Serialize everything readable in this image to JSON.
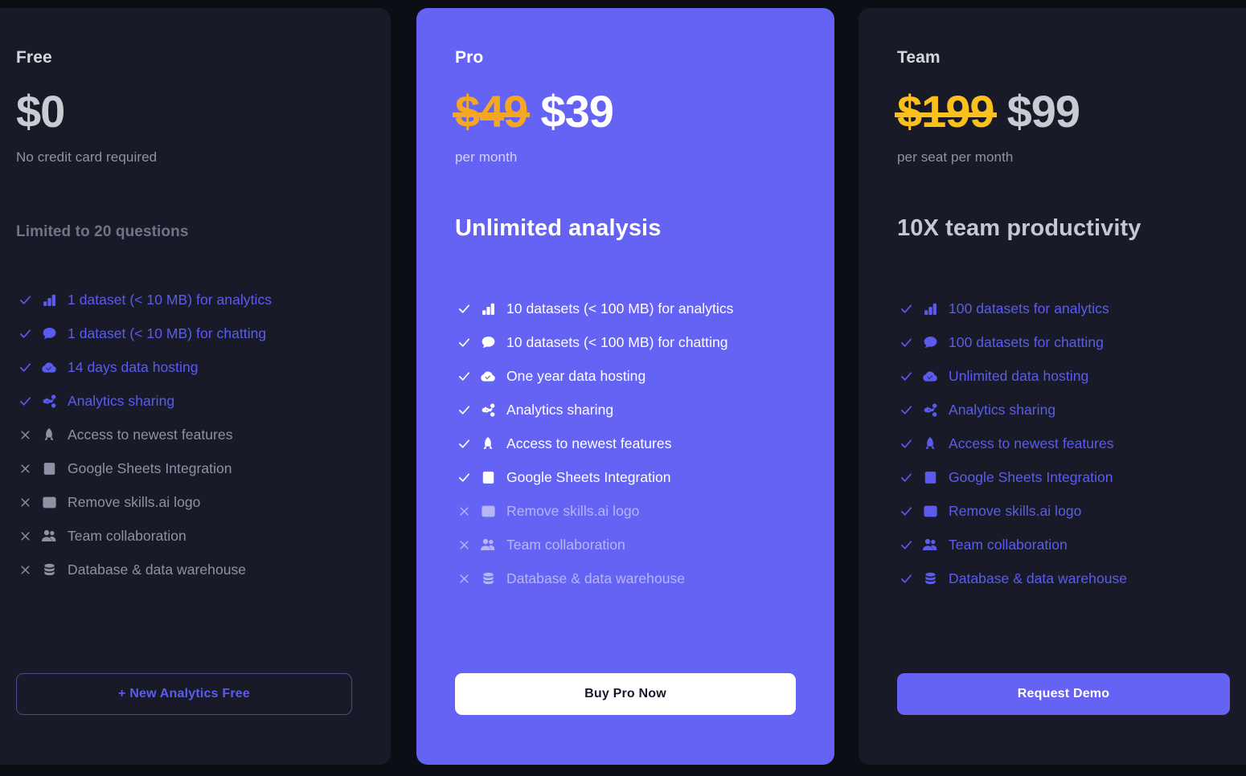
{
  "theme": {
    "page_background": "#0c0e15",
    "card_background": "#181b27",
    "accent_purple": "#6563f4",
    "feature_purple": "#5b5bf0",
    "strike_orange": "#f5a623",
    "strike_yellow": "#fcc01c",
    "muted_text": "#8d92a4"
  },
  "plans": [
    {
      "id": "free",
      "name": "Free",
      "old_price": "",
      "price": "$0",
      "price_note": "No credit card required",
      "tagline": "Limited to 20 questions",
      "cta_label": "+ New Analytics Free",
      "features": [
        {
          "icon": "bar-chart-icon",
          "label": "1 dataset (< 10 MB) for analytics",
          "included": true
        },
        {
          "icon": "chat-bubble-icon",
          "label": "1 dataset (< 10 MB) for chatting",
          "included": true
        },
        {
          "icon": "cloud-check-icon",
          "label": "14 days data hosting",
          "included": true
        },
        {
          "icon": "share-icon",
          "label": "Analytics sharing",
          "included": true
        },
        {
          "icon": "rocket-icon",
          "label": "Access to newest features",
          "included": false
        },
        {
          "icon": "spreadsheet-icon",
          "label": "Google Sheets Integration",
          "included": false
        },
        {
          "icon": "image-icon",
          "label": "Remove skills.ai logo",
          "included": false
        },
        {
          "icon": "people-icon",
          "label": "Team collaboration",
          "included": false
        },
        {
          "icon": "database-icon",
          "label": "Database & data warehouse",
          "included": false
        }
      ]
    },
    {
      "id": "pro",
      "name": "Pro",
      "old_price": "$49",
      "price": "$39",
      "price_note": "per month",
      "tagline": "Unlimited analysis",
      "cta_label": "Buy Pro Now",
      "features": [
        {
          "icon": "bar-chart-icon",
          "label": "10 datasets (< 100 MB) for analytics",
          "included": true
        },
        {
          "icon": "chat-bubble-icon",
          "label": "10 datasets (< 100 MB) for chatting",
          "included": true
        },
        {
          "icon": "cloud-check-icon",
          "label": "One year data hosting",
          "included": true
        },
        {
          "icon": "share-icon",
          "label": "Analytics sharing",
          "included": true
        },
        {
          "icon": "rocket-icon",
          "label": "Access to newest features",
          "included": true
        },
        {
          "icon": "spreadsheet-icon",
          "label": "Google Sheets Integration",
          "included": true
        },
        {
          "icon": "image-icon",
          "label": "Remove skills.ai logo",
          "included": false
        },
        {
          "icon": "people-icon",
          "label": "Team collaboration",
          "included": false
        },
        {
          "icon": "database-icon",
          "label": "Database & data warehouse",
          "included": false
        }
      ]
    },
    {
      "id": "team",
      "name": "Team",
      "old_price": "$199",
      "price": "$99",
      "price_note": "per seat per month",
      "tagline": "10X team productivity",
      "cta_label": "Request Demo",
      "features": [
        {
          "icon": "bar-chart-icon",
          "label": "100 datasets for analytics",
          "included": true
        },
        {
          "icon": "chat-bubble-icon",
          "label": "100 datasets for chatting",
          "included": true
        },
        {
          "icon": "cloud-check-icon",
          "label": "Unlimited data hosting",
          "included": true
        },
        {
          "icon": "share-icon",
          "label": "Analytics sharing",
          "included": true
        },
        {
          "icon": "rocket-icon",
          "label": "Access to newest features",
          "included": true
        },
        {
          "icon": "spreadsheet-icon",
          "label": "Google Sheets Integration",
          "included": true
        },
        {
          "icon": "image-icon",
          "label": "Remove skills.ai logo",
          "included": true
        },
        {
          "icon": "people-icon",
          "label": "Team collaboration",
          "included": true
        },
        {
          "icon": "database-icon",
          "label": "Database & data warehouse",
          "included": true
        }
      ]
    }
  ]
}
